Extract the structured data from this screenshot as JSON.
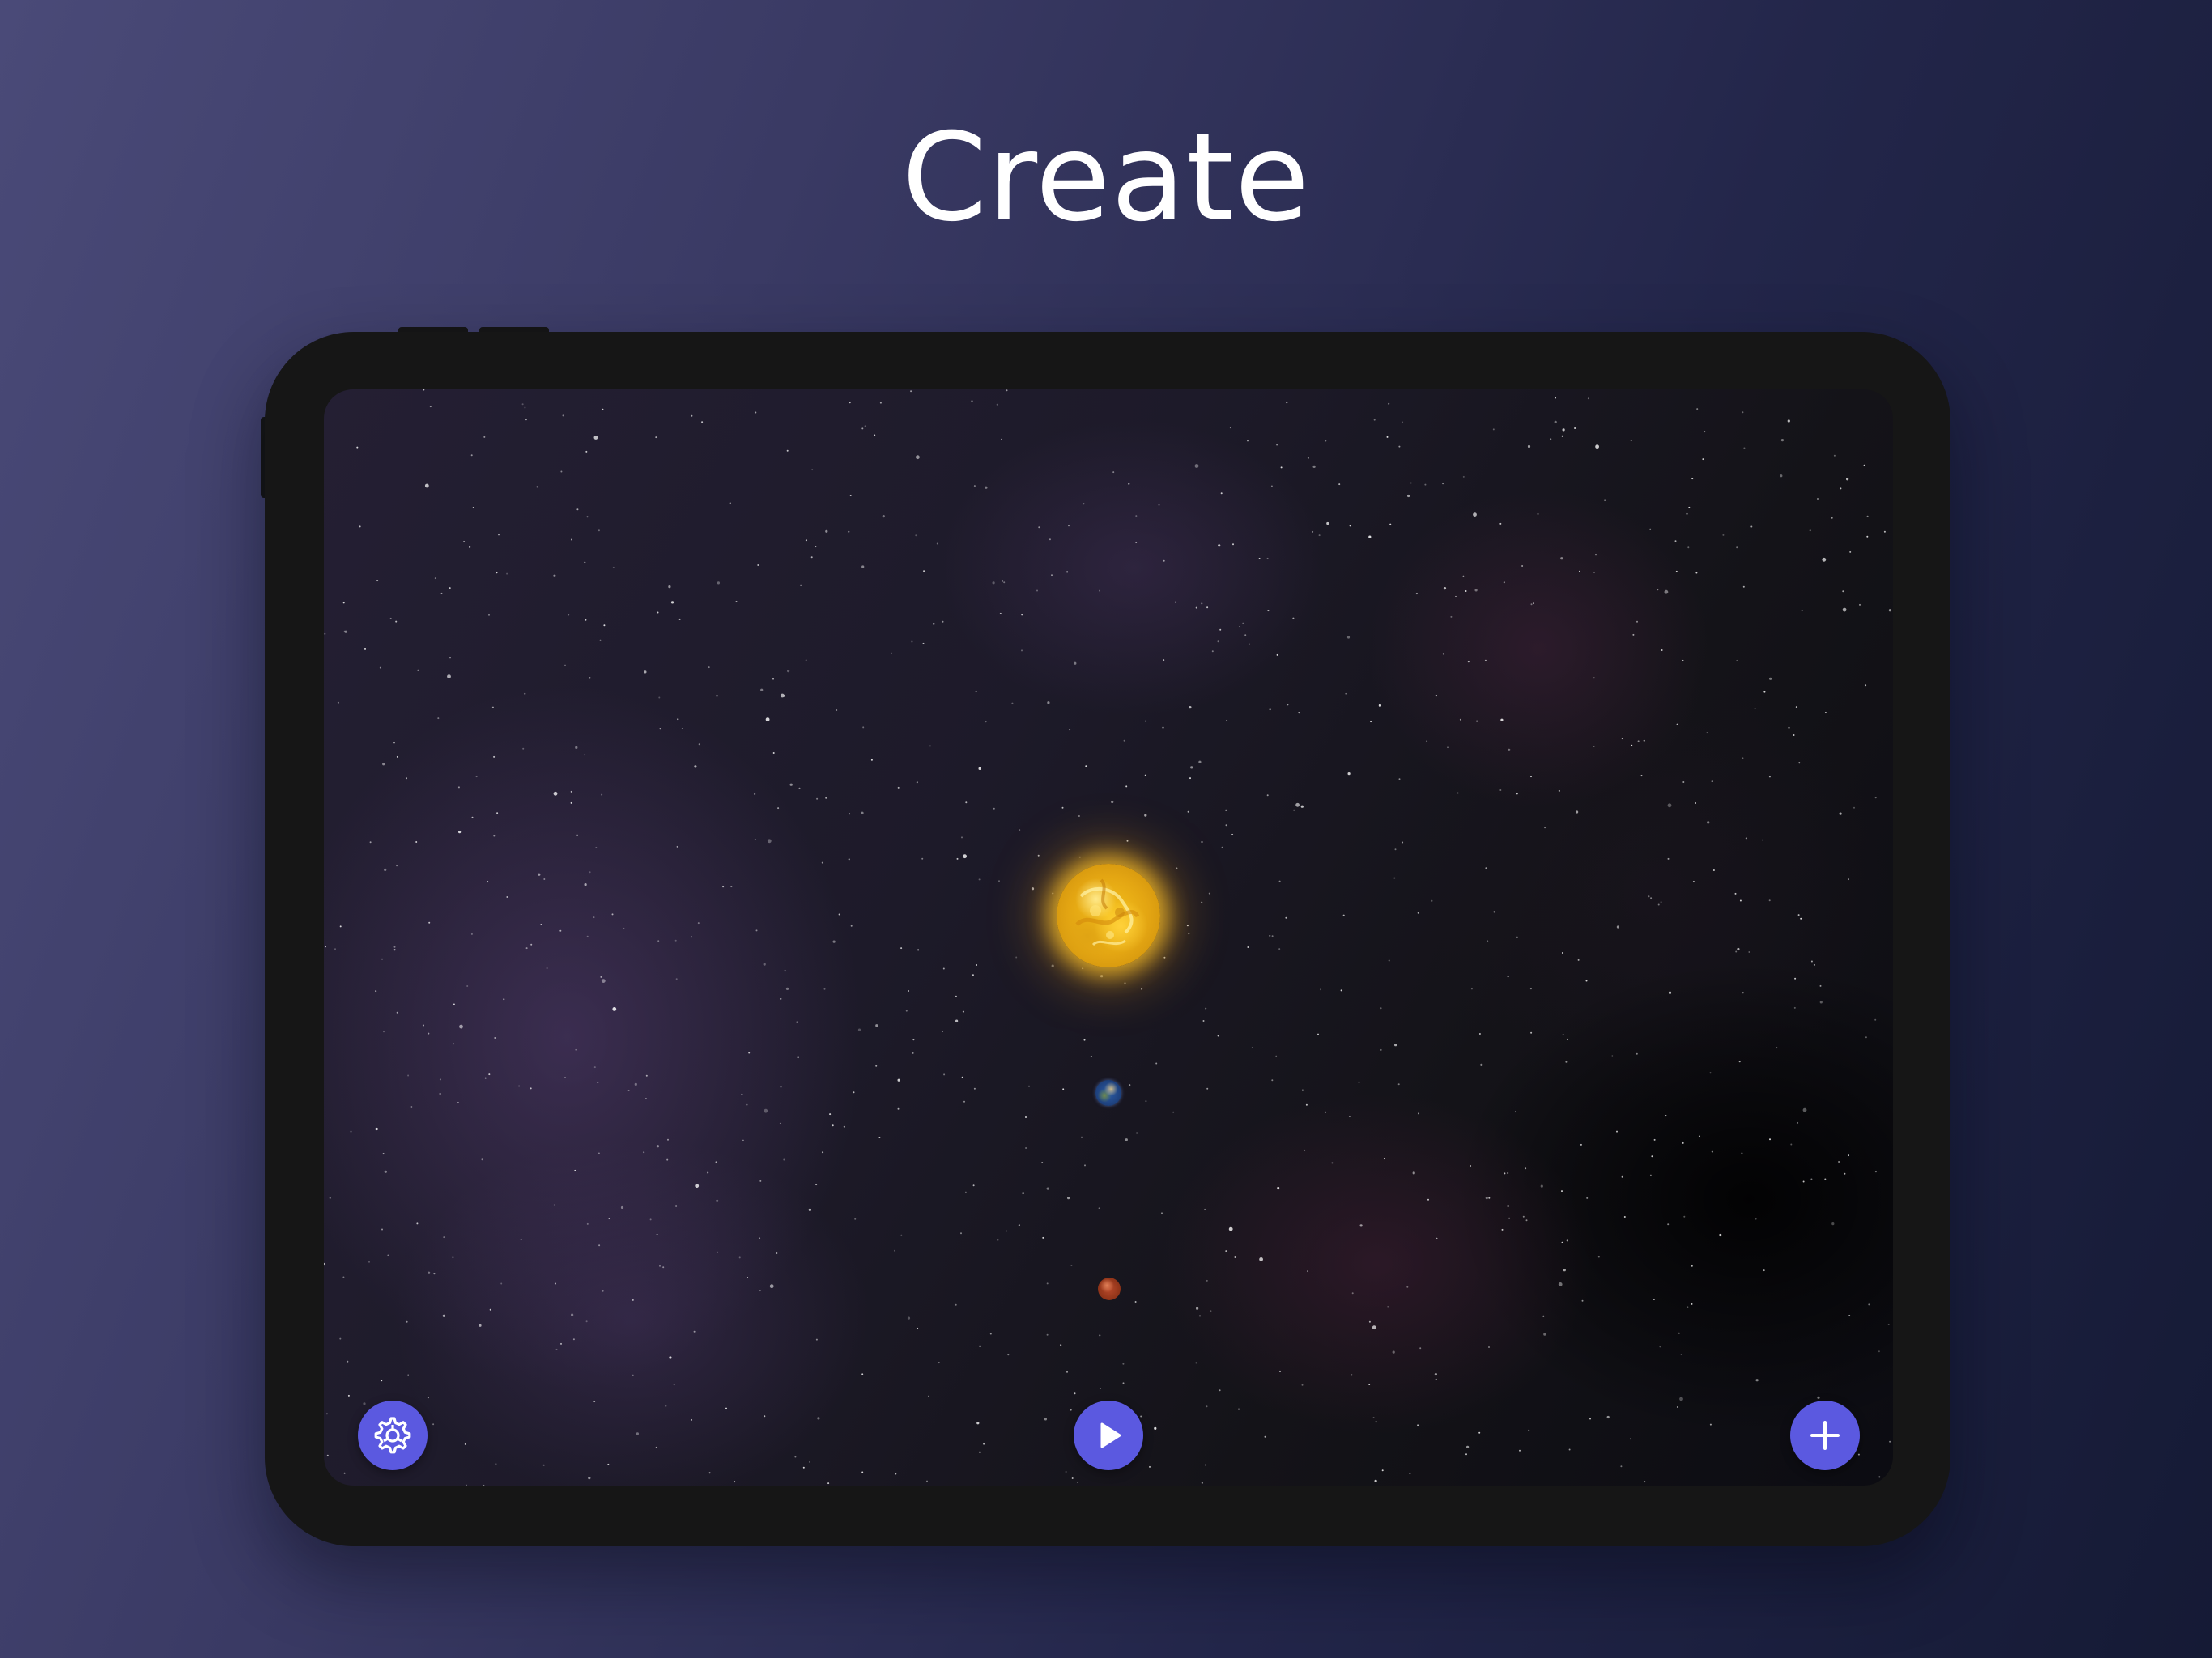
{
  "headline": "Create",
  "colors": {
    "background_start": "#4a4a78",
    "background_end": "#151a35",
    "device_frame": "#161616",
    "button_accent": "#5b59e0",
    "sun": "#f6c21d",
    "earth": "#2d5da8",
    "mars": "#b8492a"
  },
  "scene": {
    "bodies": [
      {
        "kind": "star",
        "name": "sun"
      },
      {
        "kind": "planet",
        "name": "earth"
      },
      {
        "kind": "planet",
        "name": "mars"
      }
    ]
  },
  "toolbar": {
    "settings": {
      "icon": "gear-icon"
    },
    "play": {
      "icon": "play-icon"
    },
    "add": {
      "icon": "plus-icon"
    }
  }
}
